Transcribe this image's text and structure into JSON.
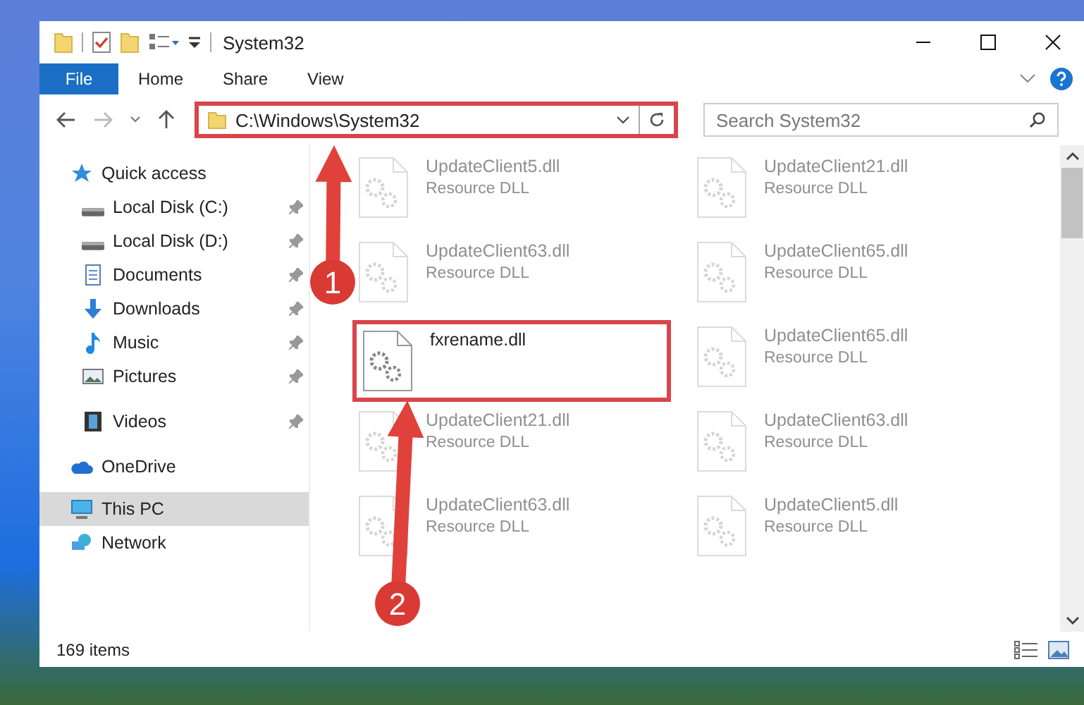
{
  "window": {
    "title": "System32"
  },
  "ribbon": {
    "tabs": [
      {
        "label": "File",
        "selected": true
      },
      {
        "label": "Home",
        "selected": false
      },
      {
        "label": "Share",
        "selected": false
      },
      {
        "label": "View",
        "selected": false
      }
    ]
  },
  "navigation": {
    "address": "C:\\Windows\\System32",
    "highlighted": true,
    "search": {
      "placeholder": "Search System32"
    }
  },
  "sidebar": {
    "items": [
      {
        "label": "Quick access",
        "kind": "star",
        "selected": false,
        "children": [
          {
            "label": "Local Disk (C:)",
            "kind": "drive",
            "pinned": true,
            "selected": false
          },
          {
            "label": "Local Disk (D:)",
            "kind": "drive",
            "pinned": true,
            "selected": false
          },
          {
            "label": "Documents",
            "kind": "documents",
            "pinned": true,
            "selected": false
          },
          {
            "label": "Downloads",
            "kind": "download",
            "pinned": true,
            "selected": false
          },
          {
            "label": "Music",
            "kind": "music",
            "pinned": true,
            "selected": false
          },
          {
            "label": "Pictures",
            "kind": "pictures",
            "pinned": true,
            "selected": false
          },
          {
            "label": "Videos",
            "kind": "videos",
            "pinned": true,
            "selected": false
          }
        ]
      },
      {
        "label": "OneDrive",
        "kind": "cloud",
        "selected": false
      },
      {
        "label": "This PC",
        "kind": "pc",
        "selected": true
      },
      {
        "label": "Network",
        "kind": "network",
        "selected": false
      }
    ]
  },
  "files": [
    {
      "name": "UpdateClient5.dll",
      "type": "Resource DLL",
      "faded": true,
      "highlighted": false
    },
    {
      "name": "UpdateClient21.dll",
      "type": "Resource DLL",
      "faded": true,
      "highlighted": false
    },
    {
      "name": "UpdateClient63.dll",
      "type": "Resource DLL",
      "faded": true,
      "highlighted": false
    },
    {
      "name": "UpdateClient65.dll",
      "type": "Resource DLL",
      "faded": true,
      "highlighted": false
    },
    {
      "name": "fxrename.dll",
      "faded": false,
      "highlighted": true
    },
    {
      "name": "UpdateClient65.dll",
      "type": "Resource DLL",
      "faded": true,
      "highlighted": false
    },
    {
      "name": "UpdateClient21.dll",
      "type": "Resource DLL",
      "faded": true,
      "highlighted": false
    },
    {
      "name": "UpdateClient63.dll",
      "type": "Resource DLL",
      "faded": true,
      "highlighted": false
    },
    {
      "name": "UpdateClient63.dll",
      "type": "Resource DLL",
      "faded": true,
      "highlighted": false
    },
    {
      "name": "UpdateClient5.dll",
      "type": "Resource DLL",
      "faded": true,
      "highlighted": false
    }
  ],
  "status_bar": {
    "item_count": "169 items"
  },
  "annotations": [
    {
      "number": "1"
    },
    {
      "number": "2"
    }
  ]
}
